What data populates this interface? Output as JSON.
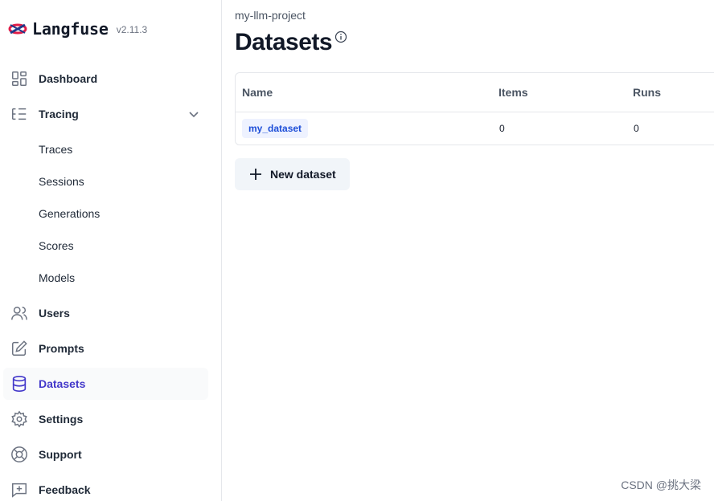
{
  "brand": {
    "name": "Langfuse",
    "version": "v2.11.3"
  },
  "sidebar": {
    "items": [
      {
        "label": "Dashboard",
        "icon": "dashboard-icon"
      },
      {
        "label": "Tracing",
        "icon": "tracing-icon",
        "expanded": true
      },
      {
        "label": "Users",
        "icon": "users-icon"
      },
      {
        "label": "Prompts",
        "icon": "prompts-icon"
      },
      {
        "label": "Datasets",
        "icon": "datasets-icon",
        "active": true
      },
      {
        "label": "Settings",
        "icon": "settings-icon"
      },
      {
        "label": "Support",
        "icon": "support-icon"
      },
      {
        "label": "Feedback",
        "icon": "feedback-icon"
      }
    ],
    "tracing_sub": [
      "Traces",
      "Sessions",
      "Generations",
      "Scores",
      "Models"
    ]
  },
  "main": {
    "breadcrumb": "my-llm-project",
    "title": "Datasets",
    "table": {
      "columns": [
        "Name",
        "Items",
        "Runs"
      ],
      "rows": [
        {
          "name": "my_dataset",
          "items": "0",
          "runs": "0"
        }
      ]
    },
    "new_button": "New dataset"
  },
  "watermark": "CSDN @挑大梁",
  "colors": {
    "active": "#4338ca",
    "badge_bg": "#eef2ff",
    "badge_text": "#1d4ed8"
  }
}
